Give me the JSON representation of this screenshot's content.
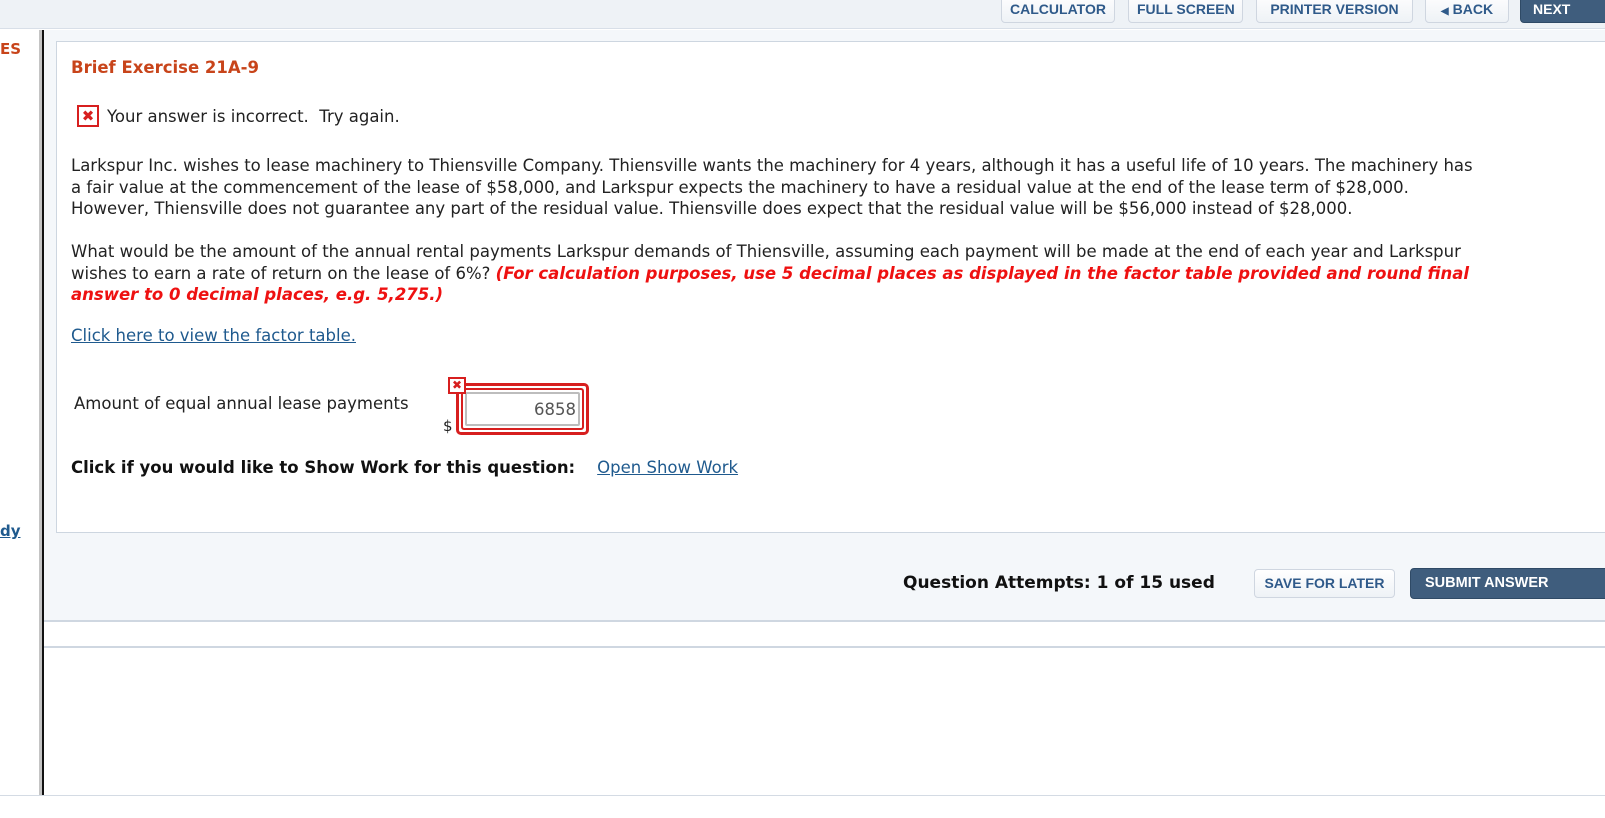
{
  "toolbar": {
    "calculator": "CALCULATOR",
    "full_screen": "FULL SCREEN",
    "printer_version": "PRINTER VERSION",
    "back": "BACK",
    "back_icon": "caret-left-icon",
    "next": "NEXT"
  },
  "sidebar": {
    "heading_fragment": "ES",
    "link_fragment": "dy"
  },
  "question": {
    "title": "Brief Exercise 21A-9",
    "status_icon": "x-mark-icon",
    "status_text": "Your answer is incorrect.  Try again.",
    "paragraph1_lines": [
      "Larkspur Inc. wishes to lease machinery to Thiensville Company. Thiensville wants the machinery for 4 years, although it has a useful life of 10 years. The machinery has",
      "a fair value at the commencement of the lease of $58,000, and Larkspur expects the machinery to have a residual value at the end of the lease term of $28,000.",
      "However, Thiensville does not guarantee any part of the residual value. Thiensville does expect that the residual value will be $56,000 instead of $28,000."
    ],
    "paragraph2_line1": "What would be the amount of the annual rental payments Larkspur demands of Thiensville, assuming each payment will be made at the end of each year and Larkspur",
    "paragraph2_line2": "wishes to earn a rate of return on the lease of 6%?",
    "instruction_line2": "(For calculation purposes, use 5 decimal places as displayed in the factor table provided and round final",
    "instruction_line3": "answer to 0 decimal places, e.g. 5,275.)",
    "factor_link": "Click here to view the factor table.",
    "answer_label": "Amount of equal annual lease payments",
    "currency_symbol": "$",
    "answer_value": "6858",
    "answer_status": "incorrect",
    "show_work_prompt": "Click if you would like to Show Work for this question:",
    "show_work_link": "Open Show Work"
  },
  "footer": {
    "attempts": "Question Attempts: 1 of 15 used",
    "save_for_later": "SAVE FOR LATER",
    "submit_answer": "SUBMIT ANSWER"
  },
  "colors": {
    "title_orange": "#c8441a",
    "error_red": "#d71f1f",
    "instruction_red": "#ee1111",
    "link_blue": "#1f5a8e",
    "primary_button": "#3f5d7d"
  }
}
